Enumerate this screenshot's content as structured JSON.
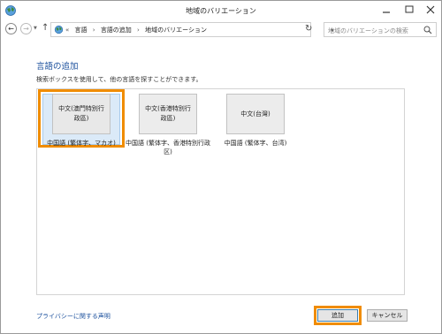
{
  "window": {
    "title": "地域のバリエーション"
  },
  "nav": {
    "breadcrumbs": [
      "言語",
      "言語の追加",
      "地域のバリエーション"
    ],
    "search_placeholder": "地域のバリエーションの検索"
  },
  "main": {
    "heading": "言語の追加",
    "description": "検索ボックスを使用して、他の言語を探すことができます。",
    "languages": [
      {
        "native": "中文(澳門特別行政區)",
        "name": "中国語 (繁体字、マカオ)",
        "selected": true
      },
      {
        "native": "中文(香港特別行政區)",
        "name": "中国語 (繁体字、香港特別行政区)",
        "selected": false
      },
      {
        "native": "中文(台灣)",
        "name": "中国語 (繁体字、台湾)",
        "selected": false
      }
    ]
  },
  "footer": {
    "privacy_link": "プライバシーに関する声明",
    "add_label": "追加",
    "cancel_label": "キャンセル"
  },
  "colors": {
    "accent": "#1a4f9c",
    "highlight": "#f08c00",
    "selection": "#dbeaf8"
  }
}
